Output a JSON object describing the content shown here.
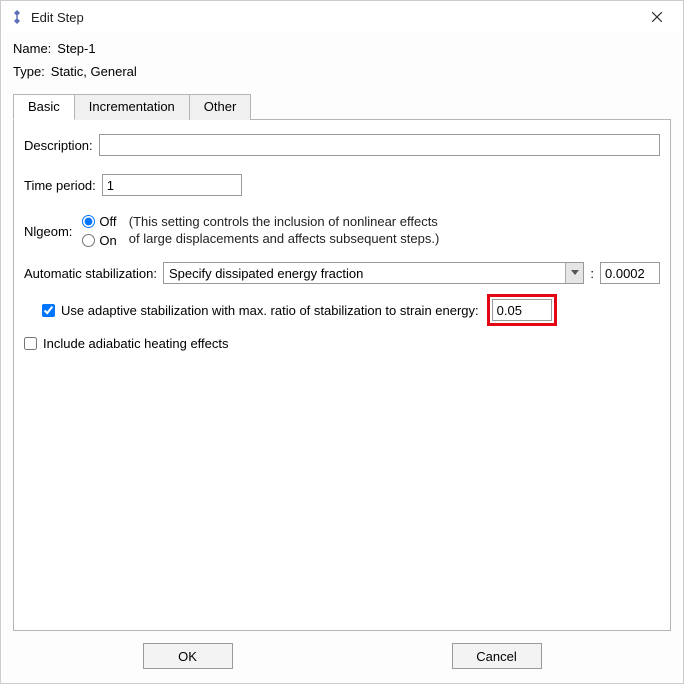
{
  "window": {
    "title": "Edit Step"
  },
  "header": {
    "name_label": "Name:",
    "name_value": "Step-1",
    "type_label": "Type:",
    "type_value": "Static, General"
  },
  "tabs": {
    "basic": "Basic",
    "incrementation": "Incrementation",
    "other": "Other"
  },
  "basic": {
    "description_label": "Description:",
    "description_value": "",
    "time_period_label": "Time period:",
    "time_period_value": "1",
    "nlgeom_label": "Nlgeom:",
    "nlgeom_off": "Off",
    "nlgeom_on": "On",
    "nlgeom_note_line1": "(This setting controls the inclusion of nonlinear effects",
    "nlgeom_note_line2": "of large displacements and affects subsequent steps.)",
    "auto_stab_label": "Automatic stabilization:",
    "auto_stab_option": "Specify dissipated energy fraction",
    "auto_stab_colon": ":",
    "auto_stab_value": "0.0002",
    "adaptive_check_label": "Use adaptive stabilization with max. ratio of stabilization to strain energy:",
    "adaptive_value": "0.05",
    "adiabatic_label": "Include adiabatic heating effects"
  },
  "footer": {
    "ok": "OK",
    "cancel": "Cancel"
  }
}
